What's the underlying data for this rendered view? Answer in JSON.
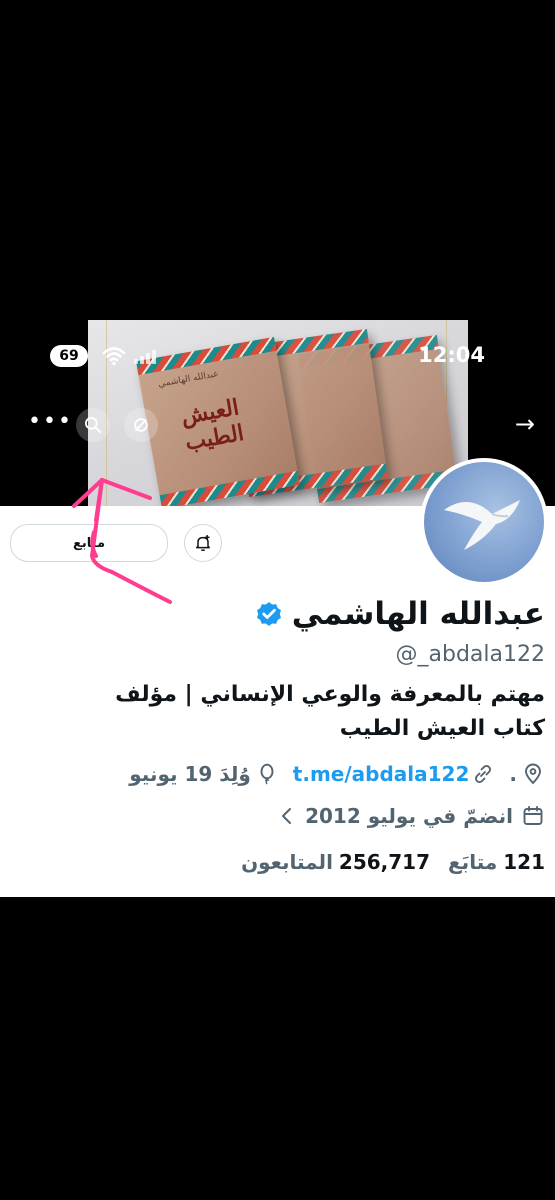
{
  "status_bar": {
    "time": "12:04",
    "battery": "69"
  },
  "cover": {
    "book_title": "العيش الطيب",
    "book_author": "عبدالله الهاشمي"
  },
  "profile": {
    "name": "عبدالله الهاشمي",
    "handle": "@_abdala122",
    "bio_line1": "مهتم بالمعرفة والوعي الإنساني | مؤلف",
    "bio_line2": "كتاب العيش الطيب",
    "location": ".",
    "link": "t.me/abdala122",
    "birthday": "وُلِدَ 19 يونيو",
    "joined": "انضمّ في يوليو 2012",
    "following_count": "121",
    "following_label": "متابَع",
    "followers_count": "256,717",
    "followers_label": "المتابعون",
    "follow_button": "متابع"
  },
  "colors": {
    "accent": "#1d9bf0",
    "annotation": "#ff3c8e",
    "text": "#0f1419",
    "muted": "#536471"
  },
  "icons": [
    "more-icon",
    "search-icon",
    "no-sync-icon",
    "back-arrow-icon",
    "bell-plus-icon",
    "verified-icon",
    "location-icon",
    "link-icon",
    "balloon-icon",
    "calendar-icon",
    "chevron-left-icon"
  ]
}
